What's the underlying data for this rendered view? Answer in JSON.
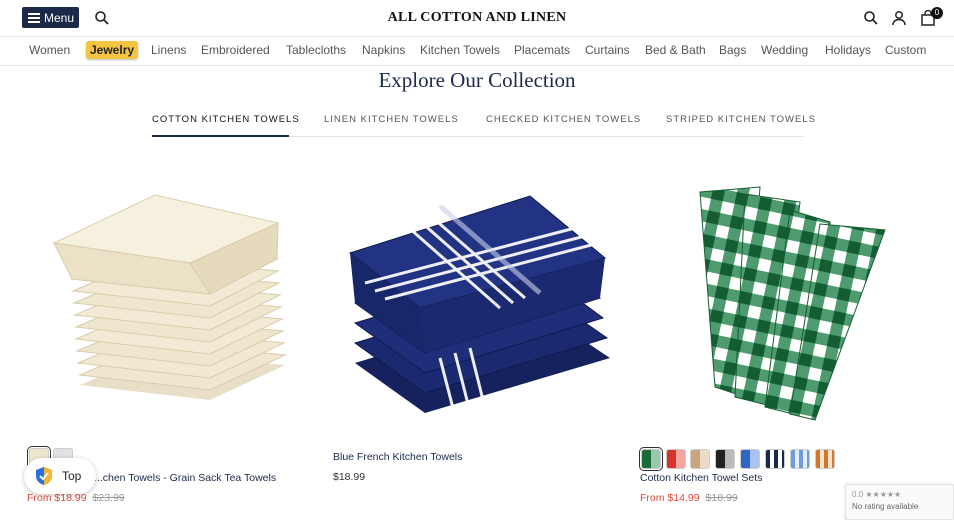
{
  "header": {
    "menu_label": "Menu",
    "brand": "ALL COTTON AND LINEN",
    "cart_count": "0"
  },
  "nav": {
    "items": [
      "Women",
      "Jewelry",
      "Linens",
      "Embroidered",
      "Tablecloths",
      "Napkins",
      "Kitchen Towels",
      "Placemats",
      "Curtains",
      "Bed & Bath",
      "Bags",
      "Wedding",
      "Holidays",
      "Custom"
    ],
    "highlighted": "Jewelry",
    "highlight_color": "#f5c542"
  },
  "section": {
    "title": "Explore Our Collection",
    "tabs": [
      "COTTON KITCHEN TOWELS",
      "LINEN KITCHEN TOWELS",
      "CHECKED KITCHEN TOWELS",
      "STRIPED KITCHEN TOWELS"
    ],
    "active_tab": "COTTON KITCHEN TOWELS"
  },
  "products": [
    {
      "name": "...chen Towels - Grain Sack Tea Towels",
      "sale_price": "From $18.99",
      "was_price": "$23.99",
      "swatches": [
        "cream",
        "light-gray"
      ]
    },
    {
      "name": "Blue French Kitchen Towels",
      "price": "$18.99"
    },
    {
      "name": "Cotton Kitchen Towel Sets",
      "sale_price": "From $14.99",
      "was_price": "$18.99",
      "swatches": [
        "green-check",
        "red-check",
        "tan-check",
        "black-check",
        "blue-check",
        "navy-gingham",
        "light-blue-gingham",
        "orange-gingham"
      ]
    }
  ],
  "widgets": {
    "top_button": "Top",
    "rating_score": "0.0",
    "rating_text": "No rating available"
  },
  "colors": {
    "navy": "#1c2a4a",
    "sale_red": "#e04b3b",
    "towel_green": "#1a6b3a",
    "towel_blue": "#1b2a70"
  }
}
